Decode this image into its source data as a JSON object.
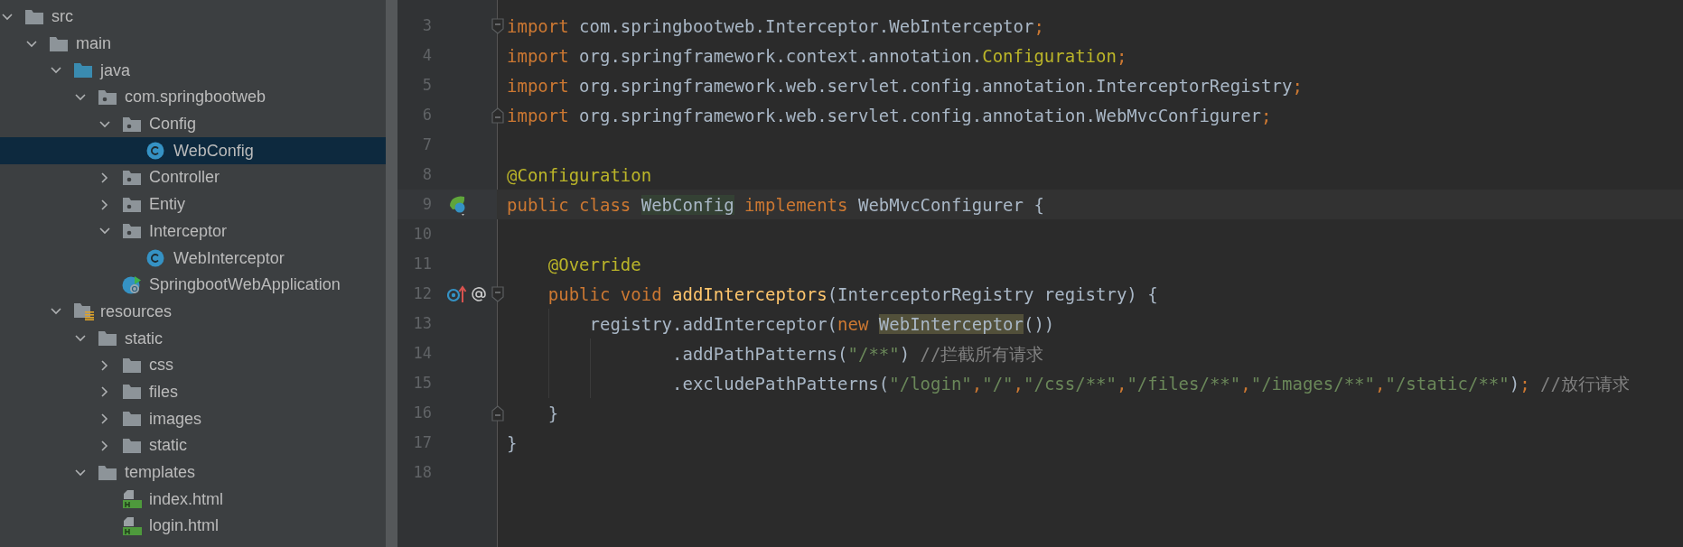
{
  "project_tree": [
    {
      "label": "src",
      "kind": "folder",
      "expanded": true,
      "selected": false,
      "children": [
        {
          "label": "main",
          "kind": "folder",
          "expanded": true,
          "selected": false,
          "children": [
            {
              "label": "java",
              "kind": "source-root",
              "expanded": true,
              "selected": false,
              "children": [
                {
                  "label": "com.springbootweb",
                  "kind": "package",
                  "expanded": true,
                  "selected": false,
                  "children": [
                    {
                      "label": "Config",
                      "kind": "package",
                      "expanded": true,
                      "selected": false,
                      "children": [
                        {
                          "label": "WebConfig",
                          "kind": "class",
                          "selected": true
                        }
                      ]
                    },
                    {
                      "label": "Controller",
                      "kind": "package",
                      "expanded": false,
                      "selected": false
                    },
                    {
                      "label": "Entiy",
                      "kind": "package",
                      "expanded": false,
                      "selected": false
                    },
                    {
                      "label": "Interceptor",
                      "kind": "package",
                      "expanded": true,
                      "selected": false,
                      "children": [
                        {
                          "label": "WebInterceptor",
                          "kind": "class",
                          "selected": false
                        }
                      ]
                    },
                    {
                      "label": "SpringbootWebApplication",
                      "kind": "app-class",
                      "selected": false
                    }
                  ]
                }
              ]
            },
            {
              "label": "resources",
              "kind": "resources-root",
              "expanded": true,
              "selected": false,
              "children": [
                {
                  "label": "static",
                  "kind": "folder",
                  "expanded": true,
                  "selected": false,
                  "children": [
                    {
                      "label": "css",
                      "kind": "folder",
                      "expanded": false,
                      "selected": false
                    },
                    {
                      "label": "files",
                      "kind": "folder",
                      "expanded": false,
                      "selected": false
                    },
                    {
                      "label": "images",
                      "kind": "folder",
                      "expanded": false,
                      "selected": false
                    },
                    {
                      "label": "static",
                      "kind": "folder",
                      "expanded": false,
                      "selected": false
                    }
                  ]
                },
                {
                  "label": "templates",
                  "kind": "folder",
                  "expanded": true,
                  "selected": false,
                  "children": [
                    {
                      "label": "index.html",
                      "kind": "html",
                      "selected": false
                    },
                    {
                      "label": "login.html",
                      "kind": "html",
                      "selected": false
                    }
                  ]
                }
              ]
            }
          ]
        }
      ]
    }
  ],
  "editor": {
    "lines": [
      {
        "number": "3",
        "current": false,
        "fold": {
          "kind": "start"
        },
        "tokens": [
          {
            "kind": "keyword",
            "text": "import "
          },
          {
            "kind": "plain",
            "text": "com.springbootweb.Interceptor.WebInterceptor"
          },
          {
            "kind": "keyword",
            "text": ";"
          }
        ]
      },
      {
        "number": "4",
        "current": false,
        "tokens": [
          {
            "kind": "keyword",
            "text": "import "
          },
          {
            "kind": "plain",
            "text": "org.springframework.context.annotation."
          },
          {
            "kind": "annotation",
            "text": "Configuration"
          },
          {
            "kind": "keyword",
            "text": ";"
          }
        ]
      },
      {
        "number": "5",
        "current": false,
        "tokens": [
          {
            "kind": "keyword",
            "text": "import "
          },
          {
            "kind": "plain",
            "text": "org.springframework.web.servlet.config.annotation.InterceptorRegistry"
          },
          {
            "kind": "keyword",
            "text": ";"
          }
        ]
      },
      {
        "number": "6",
        "current": false,
        "fold": {
          "kind": "end"
        },
        "tokens": [
          {
            "kind": "keyword",
            "text": "import "
          },
          {
            "kind": "plain",
            "text": "org.springframework.web.servlet.config.annotation.WebMvcConfigurer"
          },
          {
            "kind": "keyword",
            "text": ";"
          }
        ]
      },
      {
        "number": "7",
        "current": false
      },
      {
        "number": "8",
        "current": false,
        "tokens": [
          {
            "kind": "annotation",
            "text": "@Configuration"
          }
        ]
      },
      {
        "number": "9",
        "current": true,
        "gutter": {
          "kind": "bean"
        },
        "tokens": [
          {
            "kind": "keyword",
            "text": "public class "
          },
          {
            "kind": "declaration",
            "text": "WebConfig"
          },
          {
            "kind": "keyword",
            "text": " implements "
          },
          {
            "kind": "plain",
            "text": "WebMvcConfigurer {"
          }
        ]
      },
      {
        "number": "10",
        "current": false
      },
      {
        "number": "11",
        "current": false,
        "tokens": [
          {
            "kind": "annotation",
            "text": "    @Override"
          }
        ]
      },
      {
        "number": "12",
        "current": false,
        "gutter": {
          "kind": "override"
        },
        "fold": {
          "kind": "start"
        },
        "tokens": [
          {
            "kind": "keyword",
            "text": "    public void "
          },
          {
            "kind": "method",
            "text": "addInterceptors"
          },
          {
            "kind": "plain",
            "text": "(InterceptorRegistry registry) {"
          }
        ]
      },
      {
        "number": "13",
        "current": false,
        "tokens": [
          {
            "kind": "plain",
            "text": "        registry.addInterceptor("
          },
          {
            "kind": "keyword",
            "text": "new "
          },
          {
            "kind": "usage",
            "text": "WebInterceptor"
          },
          {
            "kind": "plain",
            "text": "())"
          }
        ]
      },
      {
        "number": "14",
        "current": false,
        "tokens": [
          {
            "kind": "plain",
            "text": "                .addPathPatterns("
          },
          {
            "kind": "string",
            "text": "\"/**\""
          },
          {
            "kind": "plain",
            "text": ") "
          },
          {
            "kind": "comment",
            "text": "//拦截所有请求"
          }
        ]
      },
      {
        "number": "15",
        "current": false,
        "tokens": [
          {
            "kind": "plain",
            "text": "                .excludePathPatterns("
          },
          {
            "kind": "string",
            "text": "\"/login\""
          },
          {
            "kind": "keyword",
            "text": ","
          },
          {
            "kind": "string",
            "text": "\"/\""
          },
          {
            "kind": "keyword",
            "text": ","
          },
          {
            "kind": "string",
            "text": "\"/css/**\""
          },
          {
            "kind": "keyword",
            "text": ","
          },
          {
            "kind": "string",
            "text": "\"/files/**\""
          },
          {
            "kind": "keyword",
            "text": ","
          },
          {
            "kind": "string",
            "text": "\"/images/**\""
          },
          {
            "kind": "keyword",
            "text": ","
          },
          {
            "kind": "string",
            "text": "\"/static/**\""
          },
          {
            "kind": "plain",
            "text": ")"
          },
          {
            "kind": "keyword",
            "text": "; "
          },
          {
            "kind": "comment",
            "text": "//放行请求"
          }
        ]
      },
      {
        "number": "16",
        "current": false,
        "fold": {
          "kind": "end"
        },
        "tokens": [
          {
            "kind": "plain",
            "text": "    }"
          }
        ]
      },
      {
        "number": "17",
        "current": false,
        "tokens": [
          {
            "kind": "plain",
            "text": "}"
          }
        ]
      },
      {
        "number": "18",
        "current": false
      }
    ]
  }
}
